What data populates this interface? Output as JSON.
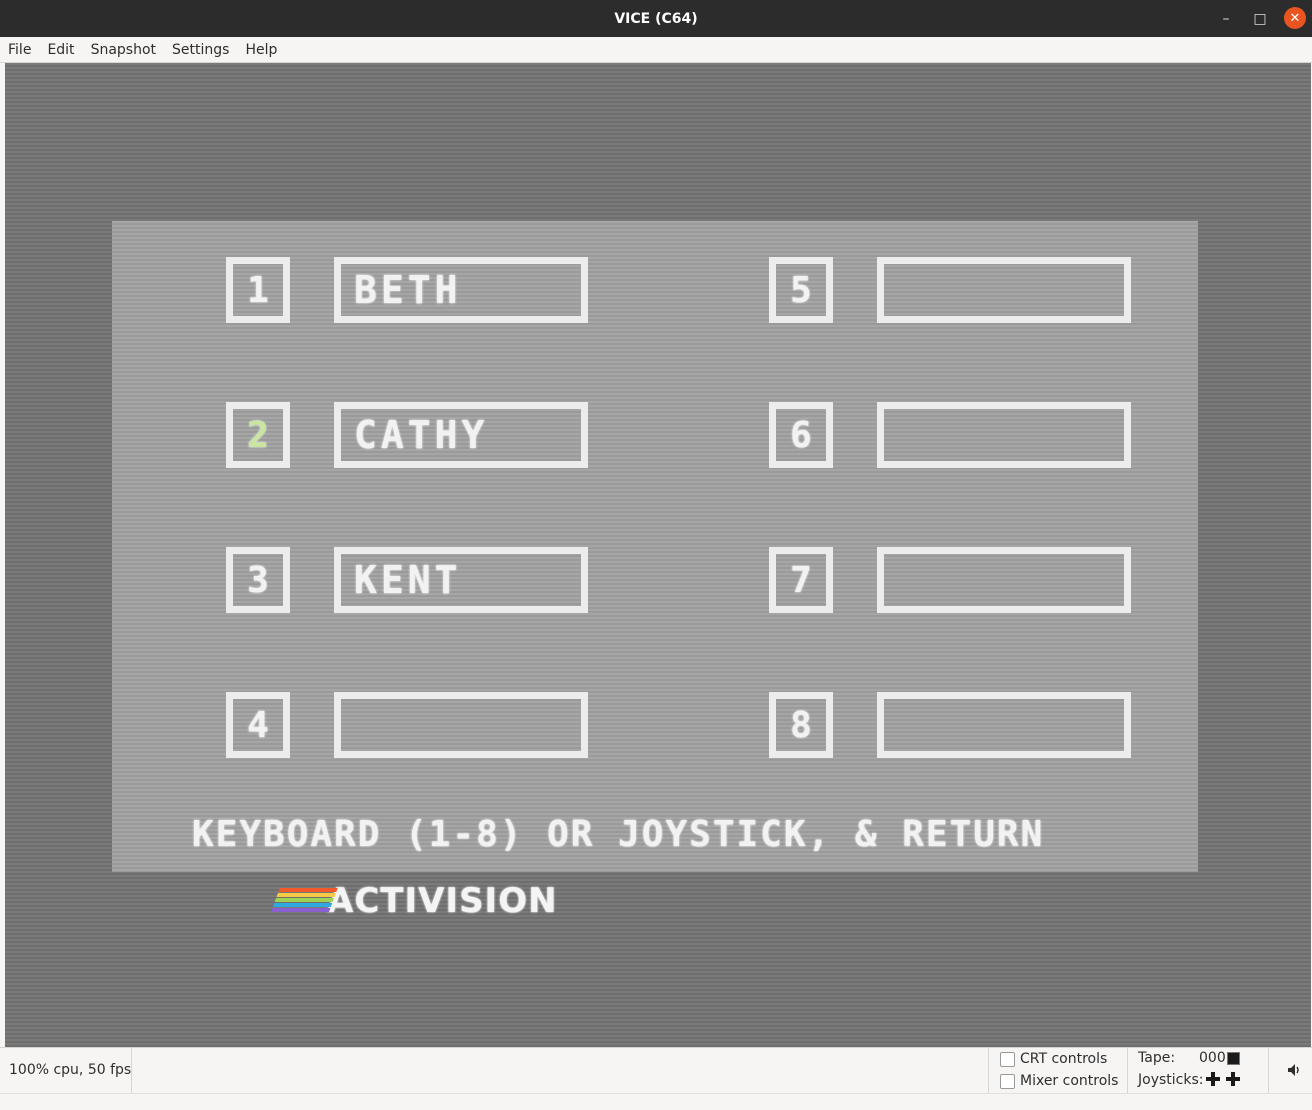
{
  "window": {
    "title": "VICE (C64)",
    "minimize": "–",
    "maximize": "□",
    "close": "✕"
  },
  "menu": [
    "File",
    "Edit",
    "Snapshot",
    "Settings",
    "Help"
  ],
  "game": {
    "slots": [
      {
        "number": "1",
        "name": "BETH",
        "selected": false
      },
      {
        "number": "2",
        "name": "CATHY",
        "selected": true
      },
      {
        "number": "3",
        "name": "KENT",
        "selected": false
      },
      {
        "number": "4",
        "name": "",
        "selected": false
      },
      {
        "number": "5",
        "name": "",
        "selected": false
      },
      {
        "number": "6",
        "name": "",
        "selected": false
      },
      {
        "number": "7",
        "name": "",
        "selected": false
      },
      {
        "number": "8",
        "name": "",
        "selected": false
      }
    ],
    "prompt": "KEYBOARD (1-8) OR JOYSTICK, & RETURN",
    "logo": "ACTIVISION",
    "logo_stripe_colors": [
      "#f05a28",
      "#f7c948",
      "#9fd356",
      "#2fa8e0",
      "#8a5fd1"
    ]
  },
  "status": {
    "perf": "100% cpu, 50 fps",
    "crt_label": "CRT controls",
    "mixer_label": "Mixer controls",
    "tape_label": "Tape:",
    "tape_counter": "000",
    "joysticks_label": "Joysticks:"
  },
  "icons": {
    "volume": "speaker-icon",
    "tape": "tape-stop-icon",
    "joystick": "joystick-icon"
  }
}
